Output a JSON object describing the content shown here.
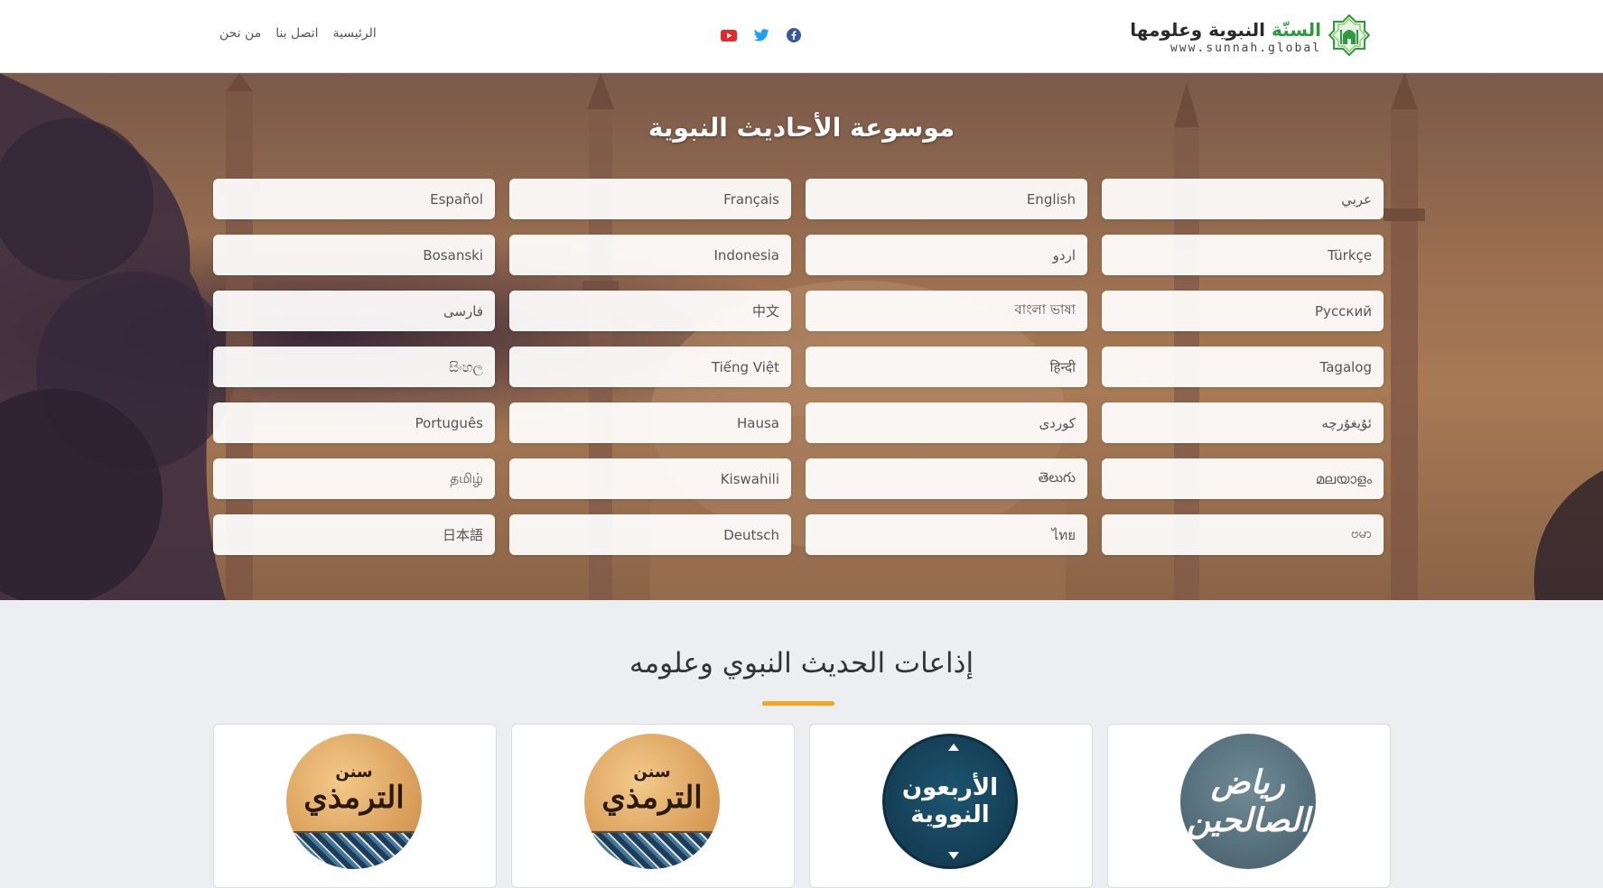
{
  "header": {
    "logo": {
      "title_green": "السنّة",
      "title_rest": "النبوية وعلومها",
      "url": "www.sunnah.global"
    },
    "nav": [
      "الرئيسية",
      "اتصل بنا",
      "من نحن"
    ],
    "social": [
      "facebook-icon",
      "twitter-icon",
      "youtube-icon"
    ],
    "colors": {
      "facebook": "#3b5998",
      "twitter": "#1da1f2",
      "youtube": "#e02b2b",
      "brand_green": "#2d9a3f"
    }
  },
  "hero": {
    "title": "موسوعة الأحاديث النبوية",
    "languages": [
      "عربي",
      "English",
      "Français",
      "Español",
      "Türkçe",
      "اردو",
      "Indonesia",
      "Bosanski",
      "Русский",
      "বাংলা ভাষা",
      "中文",
      "فارسی",
      "Tagalog",
      "हिन्दी",
      "Tiếng Việt",
      "සිංහල",
      "ئۇيغۇرچە",
      "کوردی",
      "Hausa",
      "Português",
      "മലയാളം",
      "తెలుగు",
      "Kiswahili",
      "தமிழ்",
      "ဗမာ",
      "ไทย",
      "Deutsch",
      "日本語"
    ]
  },
  "radios": {
    "title": "إذاعات الحديث النبوي وعلومه",
    "accent": "#f2a623",
    "cards": [
      {
        "style": "slate",
        "big": "رياض الصالحين"
      },
      {
        "style": "navy",
        "big": "الأربعون النووية"
      },
      {
        "style": "wood",
        "small": "سنن",
        "big": "الترمذي"
      },
      {
        "style": "wood",
        "small": "سنن",
        "big": "الترمذي"
      }
    ]
  }
}
